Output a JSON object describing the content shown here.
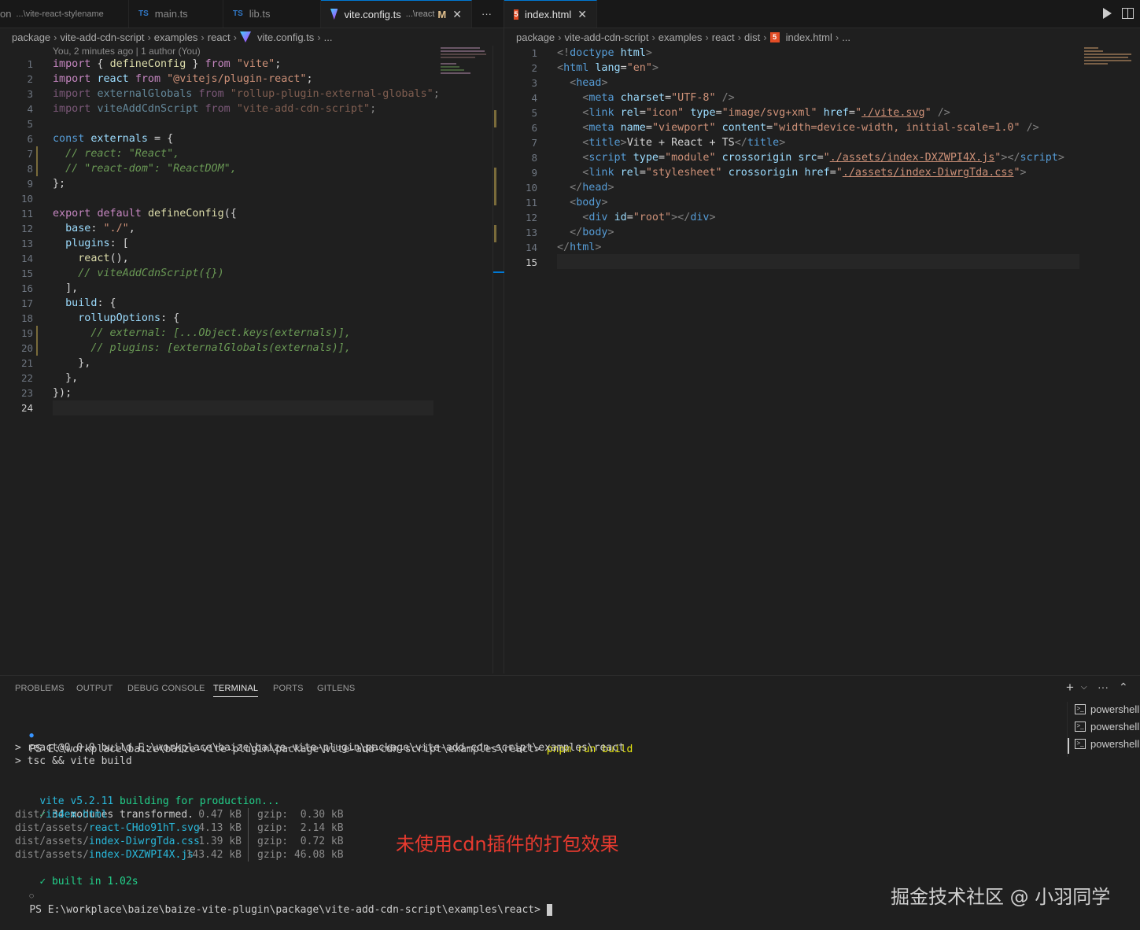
{
  "left_tabs": [
    {
      "label": "...\\vite-react-stylename",
      "prefix": "on"
    },
    {
      "label": "main.ts",
      "badge": "TS"
    },
    {
      "label": "lib.ts",
      "badge": "TS"
    },
    {
      "label": "vite.config.ts",
      "path": "...\\react",
      "modified": "M"
    }
  ],
  "left_more": "···",
  "right_tab": {
    "label": "index.html",
    "badge": "5"
  },
  "left_breadcrumb": [
    "package",
    "vite-add-cdn-script",
    "examples",
    "react",
    "vite.config.ts",
    "..."
  ],
  "right_breadcrumb": [
    "package",
    "vite-add-cdn-script",
    "examples",
    "react",
    "dist",
    "index.html",
    "..."
  ],
  "blame": "You, 2 minutes ago | 1 author (You)",
  "panel_tabs": [
    "PROBLEMS",
    "OUTPUT",
    "DEBUG CONSOLE",
    "TERMINAL",
    "PORTS",
    "GITLENS"
  ],
  "terminal": {
    "prompt1": "PS E:\\workplace\\baize\\baize-vite-plugin\\package\\vite-add-cdn-script\\examples\\react> ",
    "cmd": "pnpm run build",
    "l2": "> react@0.0.0 build E:\\workplace\\baize\\baize-vite-plugin\\package\\vite-add-cdn-script\\examples\\react",
    "l3": "> tsc && vite build",
    "vite": "vite v5.2.11",
    "building": " building for production...",
    "transformed": "34 modules transformed.",
    "files": [
      {
        "dir": "dist/",
        "name": "index.html",
        "size": "0.47 kB",
        "gzip": "gzip:  0.30 kB"
      },
      {
        "dir": "dist/assets/",
        "name": "react-CHdo91hT.svg",
        "size": "4.13 kB",
        "gzip": "gzip:  2.14 kB"
      },
      {
        "dir": "dist/assets/",
        "name": "index-DiwrgTda.css",
        "size": "1.39 kB",
        "gzip": "gzip:  0.72 kB"
      },
      {
        "dir": "dist/assets/",
        "name": "index-DXZWPI4X.js",
        "size": "143.42 kB",
        "gzip": "gzip: 46.08 kB"
      }
    ],
    "built": "built in 1.02s",
    "prompt2": "PS E:\\workplace\\baize\\baize-vite-plugin\\package\\vite-add-cdn-script\\examples\\react> "
  },
  "annotation": "未使用cdn插件的打包效果",
  "watermark": "掘金技术社区 @ 小羽同学",
  "shells": [
    "powershell",
    "powershell",
    "powershell"
  ],
  "colors": {
    "accent": "#0078d4",
    "annotation": "#e83a2f",
    "background": "#1f1f1f"
  }
}
